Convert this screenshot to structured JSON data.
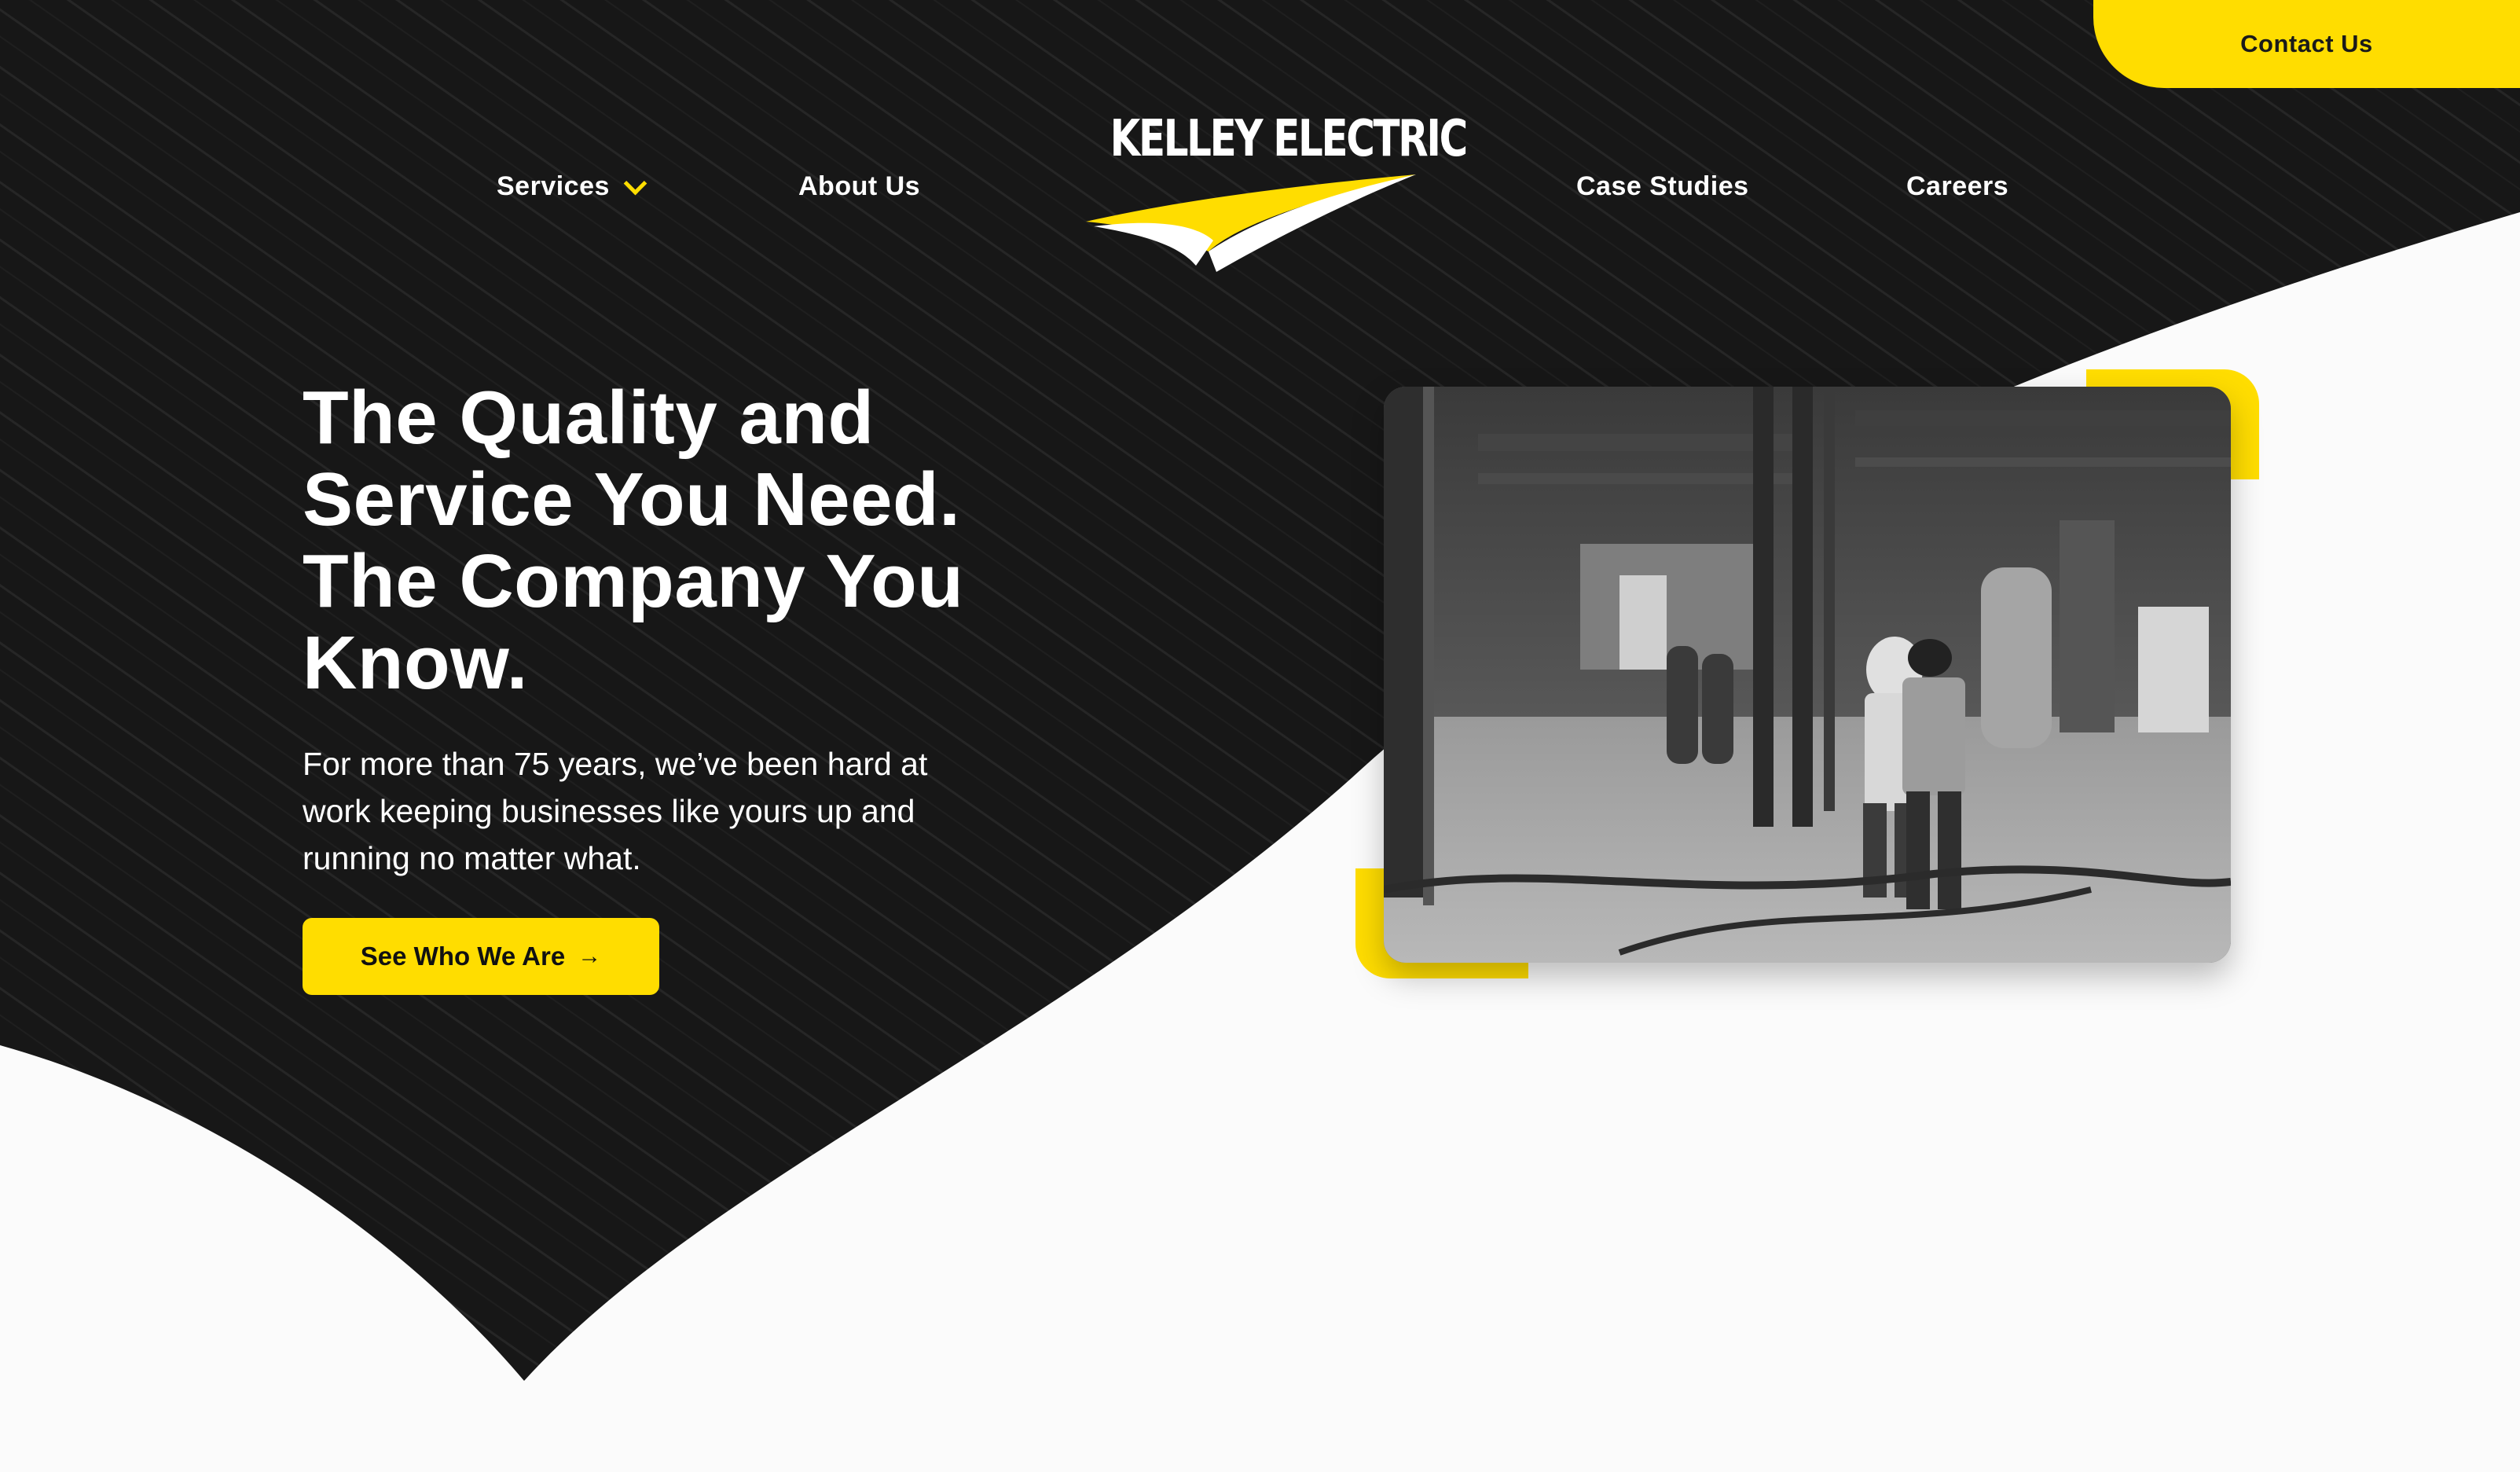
{
  "header": {
    "contact_label": "Contact Us",
    "logo_text": "KELLEY ELECTRIC",
    "nav": {
      "services": "Services",
      "about": "About Us",
      "case_studies": "Case Studies",
      "careers": "Careers"
    }
  },
  "hero": {
    "title_lines": [
      "The Quality and",
      "Service You Need.",
      "The Company You",
      "Know."
    ],
    "subtitle_lines": [
      "For more than 75 years, we’ve been hard at",
      "work keeping businesses like yours up and",
      "running no matter what."
    ],
    "cta_label": "See Who We Are",
    "cta_icon": "arrow-right-icon"
  },
  "colors": {
    "dark": "#171717",
    "accent": "#ffdd00",
    "light": "#fbfbfb"
  }
}
